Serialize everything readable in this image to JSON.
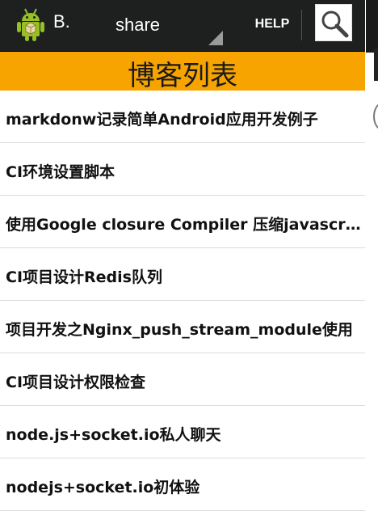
{
  "action_bar": {
    "app_title": "B.",
    "spinner_value": "share",
    "help_label": "HELP",
    "icons": [
      "android-icon",
      "dropdown-triangle-icon",
      "search-icon"
    ]
  },
  "header": {
    "title": "博客列表"
  },
  "blog_list": {
    "items": [
      {
        "label": "markdonw记录简单Android应用开发例子"
      },
      {
        "label": "CI环境设置脚本"
      },
      {
        "label": "使用Google closure Compiler 压缩javascript"
      },
      {
        "label": "CI项目设计Redis队列"
      },
      {
        "label": "项目开发之Nginx_push_stream_module使用"
      },
      {
        "label": "CI项目设计权限检查"
      },
      {
        "label": "node.js+socket.io私人聊天"
      },
      {
        "label": "nodejs+socket.io初体验"
      }
    ]
  },
  "colors": {
    "action_bar_bg": "#1e1f1f",
    "header_bg": "#f8a400",
    "android_green": "#97c024"
  }
}
